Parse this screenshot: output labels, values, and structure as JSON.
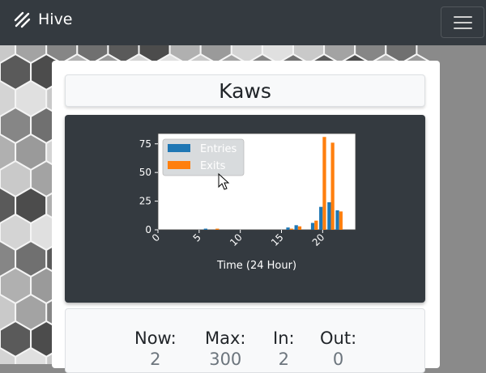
{
  "navbar": {
    "brand": "Hive",
    "brand_icon": "hive-logo-icon",
    "menu_icon": "hamburger-menu-icon"
  },
  "location": {
    "title": "Kaws"
  },
  "stats": [
    {
      "label": "Now:",
      "value": "2"
    },
    {
      "label": "Max:",
      "value": "300"
    },
    {
      "label": "In:",
      "value": "2"
    },
    {
      "label": "Out:",
      "value": "0"
    }
  ],
  "chart_data": {
    "type": "bar",
    "xlabel": "Time (24 Hour)",
    "ylabel": "",
    "x_ticks": [
      0,
      5,
      10,
      15,
      20
    ],
    "y_ticks": [
      0,
      25,
      50,
      75
    ],
    "xlim": [
      0,
      24
    ],
    "ylim": [
      0,
      84
    ],
    "legend_position": "top-left",
    "categories": [
      0,
      1,
      2,
      3,
      4,
      5,
      6,
      7,
      8,
      9,
      10,
      11,
      12,
      13,
      14,
      15,
      16,
      17,
      18,
      19,
      20,
      21,
      22,
      23
    ],
    "series": [
      {
        "name": "Entries",
        "color": "#1f77b4",
        "values": [
          0,
          0,
          0,
          0,
          0,
          0,
          1,
          0,
          0,
          0,
          0,
          0,
          0,
          0,
          0,
          0,
          2,
          4,
          0,
          6,
          20,
          24,
          17,
          0
        ]
      },
      {
        "name": "Exits",
        "color": "#ff7f0e",
        "values": [
          0,
          0,
          0,
          0,
          0,
          0,
          0,
          1,
          0,
          0,
          0,
          0,
          0,
          0,
          0,
          0,
          1,
          3,
          0,
          8,
          81,
          76,
          16,
          0
        ]
      }
    ]
  }
}
